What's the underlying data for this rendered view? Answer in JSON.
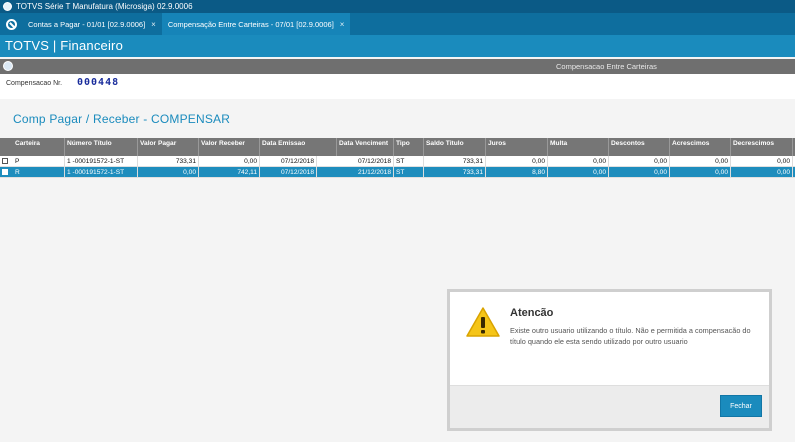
{
  "window": {
    "title": "TOTVS Série T Manufatura (Microsiga) 02.9.0006"
  },
  "tabs": [
    {
      "label": "Contas a Pagar - 01/01 [02.9.0006]",
      "close": "×"
    },
    {
      "label": "Compensação Entre Carteiras - 07/01 [02.9.0006]",
      "close": "×"
    }
  ],
  "app": {
    "title": "TOTVS | Financeiro"
  },
  "form": {
    "title": "Compensacao Entre Carteiras",
    "comp_label": "Compensacao Nr.",
    "comp_value": "000448",
    "section": "Comp Pagar / Receber - COMPENSAR"
  },
  "grid": {
    "columns": [
      "Carteira",
      "Número Título",
      "Valor Pagar",
      "Valor Receber",
      "Data Emissao",
      "Data Venciment",
      "Tipo",
      "Saldo Titulo",
      "Juros",
      "Multa",
      "Descontos",
      "Acrescimos",
      "Decrescimos"
    ],
    "rows": [
      [
        "P",
        "1 -000191572-1-ST",
        "733,31",
        "0,00",
        "07/12/2018",
        "07/12/2018",
        "ST",
        "733,31",
        "0,00",
        "0,00",
        "0,00",
        "0,00",
        "0,00"
      ],
      [
        "R",
        "1 -000191572-1-ST",
        "0,00",
        "742,11",
        "07/12/2018",
        "21/12/2018",
        "ST",
        "733,31",
        "8,80",
        "0,00",
        "0,00",
        "0,00",
        "0,00"
      ]
    ]
  },
  "dialog": {
    "title": "Atencão",
    "message": "Existe outro usuario utilizando o título. Não e permitida a compensacão do título quando ele esta sendo utilizado por outro usuario",
    "button": "Fechar",
    "icon": "warning-icon"
  },
  "colors": {
    "primary": "#1a8bbd",
    "header": "#0b5a86",
    "selected_row": "#1e8dbd",
    "warning": "#f5c518"
  }
}
